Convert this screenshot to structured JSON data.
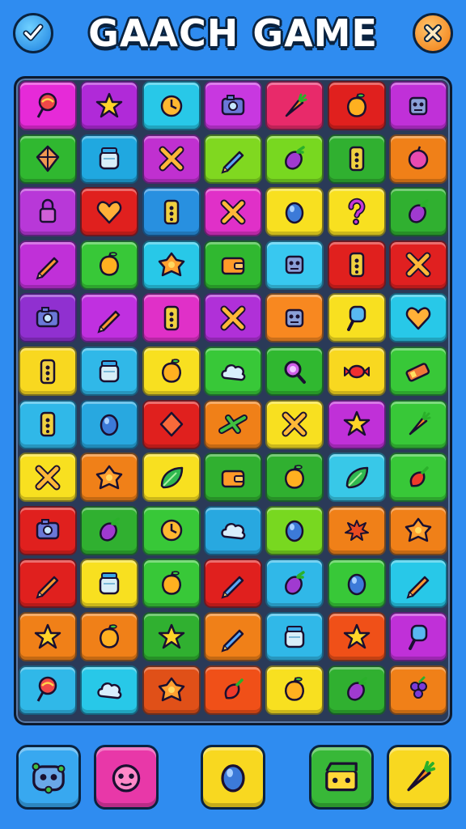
{
  "header": {
    "title": "GAACH GAME",
    "left_button_icon": "check-icon",
    "right_button_icon": "close-icon"
  },
  "board": {
    "rows": [
      [
        {
          "color": "#e62ad8",
          "icon": "lollipop-icon"
        },
        {
          "color": "#b02ad8",
          "icon": "star-icon"
        },
        {
          "color": "#28c8e8",
          "icon": "clock-icon"
        },
        {
          "color": "#c838e0",
          "icon": "camera-icon"
        },
        {
          "color": "#e82a6a",
          "icon": "carrot-icon"
        },
        {
          "color": "#e0201e",
          "icon": "fruit-icon"
        },
        {
          "color": "#c030d8",
          "icon": "robot-icon"
        }
      ],
      [
        {
          "color": "#30b830",
          "icon": "kite-icon"
        },
        {
          "color": "#20a8e0",
          "icon": "jar-icon"
        },
        {
          "color": "#c030d0",
          "icon": "cross-icon"
        },
        {
          "color": "#80d820",
          "icon": "pen-icon"
        },
        {
          "color": "#78d820",
          "icon": "eggplant-icon"
        },
        {
          "color": "#30b030",
          "icon": "phone-icon"
        },
        {
          "color": "#f08018",
          "icon": "plum-icon"
        }
      ],
      [
        {
          "color": "#b838d8",
          "icon": "lock-icon"
        },
        {
          "color": "#e0201e",
          "icon": "heart-icon"
        },
        {
          "color": "#2890e0",
          "icon": "phone-icon"
        },
        {
          "color": "#e030c8",
          "icon": "cross-icon"
        },
        {
          "color": "#f8e020",
          "icon": "orb-icon"
        },
        {
          "color": "#f8e020",
          "icon": "question-icon"
        },
        {
          "color": "#30b030",
          "icon": "eggplant-icon"
        }
      ],
      [
        {
          "color": "#c030d8",
          "icon": "pencil-icon"
        },
        {
          "color": "#38c838",
          "icon": "fruit-icon"
        },
        {
          "color": "#28c8e8",
          "icon": "flower-icon"
        },
        {
          "color": "#30b830",
          "icon": "wallet-icon"
        },
        {
          "color": "#38c8f0",
          "icon": "robot-icon"
        },
        {
          "color": "#e0201e",
          "icon": "phone-icon"
        },
        {
          "color": "#e02020",
          "icon": "cross-icon"
        }
      ],
      [
        {
          "color": "#9030d0",
          "icon": "camera-icon"
        },
        {
          "color": "#c030e0",
          "icon": "pencil-icon"
        },
        {
          "color": "#e030c8",
          "icon": "phone-icon"
        },
        {
          "color": "#b030d8",
          "icon": "cross-icon"
        },
        {
          "color": "#f88820",
          "icon": "robot-icon"
        },
        {
          "color": "#f8e020",
          "icon": "ice-cream-icon"
        },
        {
          "color": "#28c8e8",
          "icon": "heart-icon"
        }
      ],
      [
        {
          "color": "#f8d820",
          "icon": "phone-icon"
        },
        {
          "color": "#30b8e8",
          "icon": "jar-icon"
        },
        {
          "color": "#f8e020",
          "icon": "fruit-icon"
        },
        {
          "color": "#38c838",
          "icon": "cloud-icon"
        },
        {
          "color": "#30b830",
          "icon": "search-icon"
        },
        {
          "color": "#f8d820",
          "icon": "candy-icon"
        },
        {
          "color": "#38c838",
          "icon": "battery-icon"
        }
      ],
      [
        {
          "color": "#30b8e8",
          "icon": "phone-icon"
        },
        {
          "color": "#28a8e0",
          "icon": "orb-icon"
        },
        {
          "color": "#e0201e",
          "icon": "diamond-icon"
        },
        {
          "color": "#f08018",
          "icon": "plane-icon"
        },
        {
          "color": "#f8e020",
          "icon": "cross-icon"
        },
        {
          "color": "#c030d8",
          "icon": "star-icon"
        },
        {
          "color": "#38c838",
          "icon": "carrot-icon"
        }
      ],
      [
        {
          "color": "#f8e020",
          "icon": "cross-icon"
        },
        {
          "color": "#f08018",
          "icon": "flower-icon"
        },
        {
          "color": "#f8e020",
          "icon": "leaf-icon"
        },
        {
          "color": "#30b030",
          "icon": "wallet-icon"
        },
        {
          "color": "#30b030",
          "icon": "fruit-icon"
        },
        {
          "color": "#38c8e8",
          "icon": "leaf-icon"
        },
        {
          "color": "#38c838",
          "icon": "pepper-icon"
        }
      ],
      [
        {
          "color": "#e0201e",
          "icon": "camera-icon"
        },
        {
          "color": "#30b030",
          "icon": "eggplant-icon"
        },
        {
          "color": "#38c838",
          "icon": "clock-icon"
        },
        {
          "color": "#28a8e0",
          "icon": "cloud-icon"
        },
        {
          "color": "#78d820",
          "icon": "orb-icon"
        },
        {
          "color": "#f08018",
          "icon": "splat-icon"
        },
        {
          "color": "#f08018",
          "icon": "flower-icon"
        }
      ],
      [
        {
          "color": "#e0201e",
          "icon": "pencil-icon"
        },
        {
          "color": "#f8e020",
          "icon": "jar-icon"
        },
        {
          "color": "#38c838",
          "icon": "fruit-icon"
        },
        {
          "color": "#e0201e",
          "icon": "pen-icon"
        },
        {
          "color": "#30b8e8",
          "icon": "eggplant-icon"
        },
        {
          "color": "#38c838",
          "icon": "orb-icon"
        },
        {
          "color": "#28c8e8",
          "icon": "pencil-icon"
        }
      ],
      [
        {
          "color": "#f08018",
          "icon": "star-icon"
        },
        {
          "color": "#f08018",
          "icon": "fruit-icon"
        },
        {
          "color": "#30b030",
          "icon": "star-icon"
        },
        {
          "color": "#f08018",
          "icon": "pen-icon"
        },
        {
          "color": "#30b8e8",
          "icon": "jar-icon"
        },
        {
          "color": "#f05018",
          "icon": "star-icon"
        },
        {
          "color": "#c030d8",
          "icon": "ice-cream-icon"
        }
      ],
      [
        {
          "color": "#30b8e8",
          "icon": "lollipop-icon"
        },
        {
          "color": "#28c8e8",
          "icon": "cloud-icon"
        },
        {
          "color": "#e05018",
          "icon": "flower-icon"
        },
        {
          "color": "#f05018",
          "icon": "pepper-icon"
        },
        {
          "color": "#f8e020",
          "icon": "fruit-icon"
        },
        {
          "color": "#30b030",
          "icon": "eggplant-icon"
        },
        {
          "color": "#f08018",
          "icon": "grapes-icon"
        }
      ]
    ]
  },
  "toolbar": [
    {
      "name": "monster-button",
      "color": "#38a8f0",
      "icon": "monster-icon"
    },
    {
      "name": "bomb-button",
      "color": "#e838a8",
      "icon": "bomb-icon"
    },
    {
      "name": "orb-button",
      "color": "#f8d820",
      "icon": "orb-icon"
    },
    {
      "name": "clapper-button",
      "color": "#38b838",
      "icon": "clapper-icon"
    },
    {
      "name": "carrot-button",
      "color": "#f8d820",
      "icon": "carrot-icon"
    }
  ]
}
